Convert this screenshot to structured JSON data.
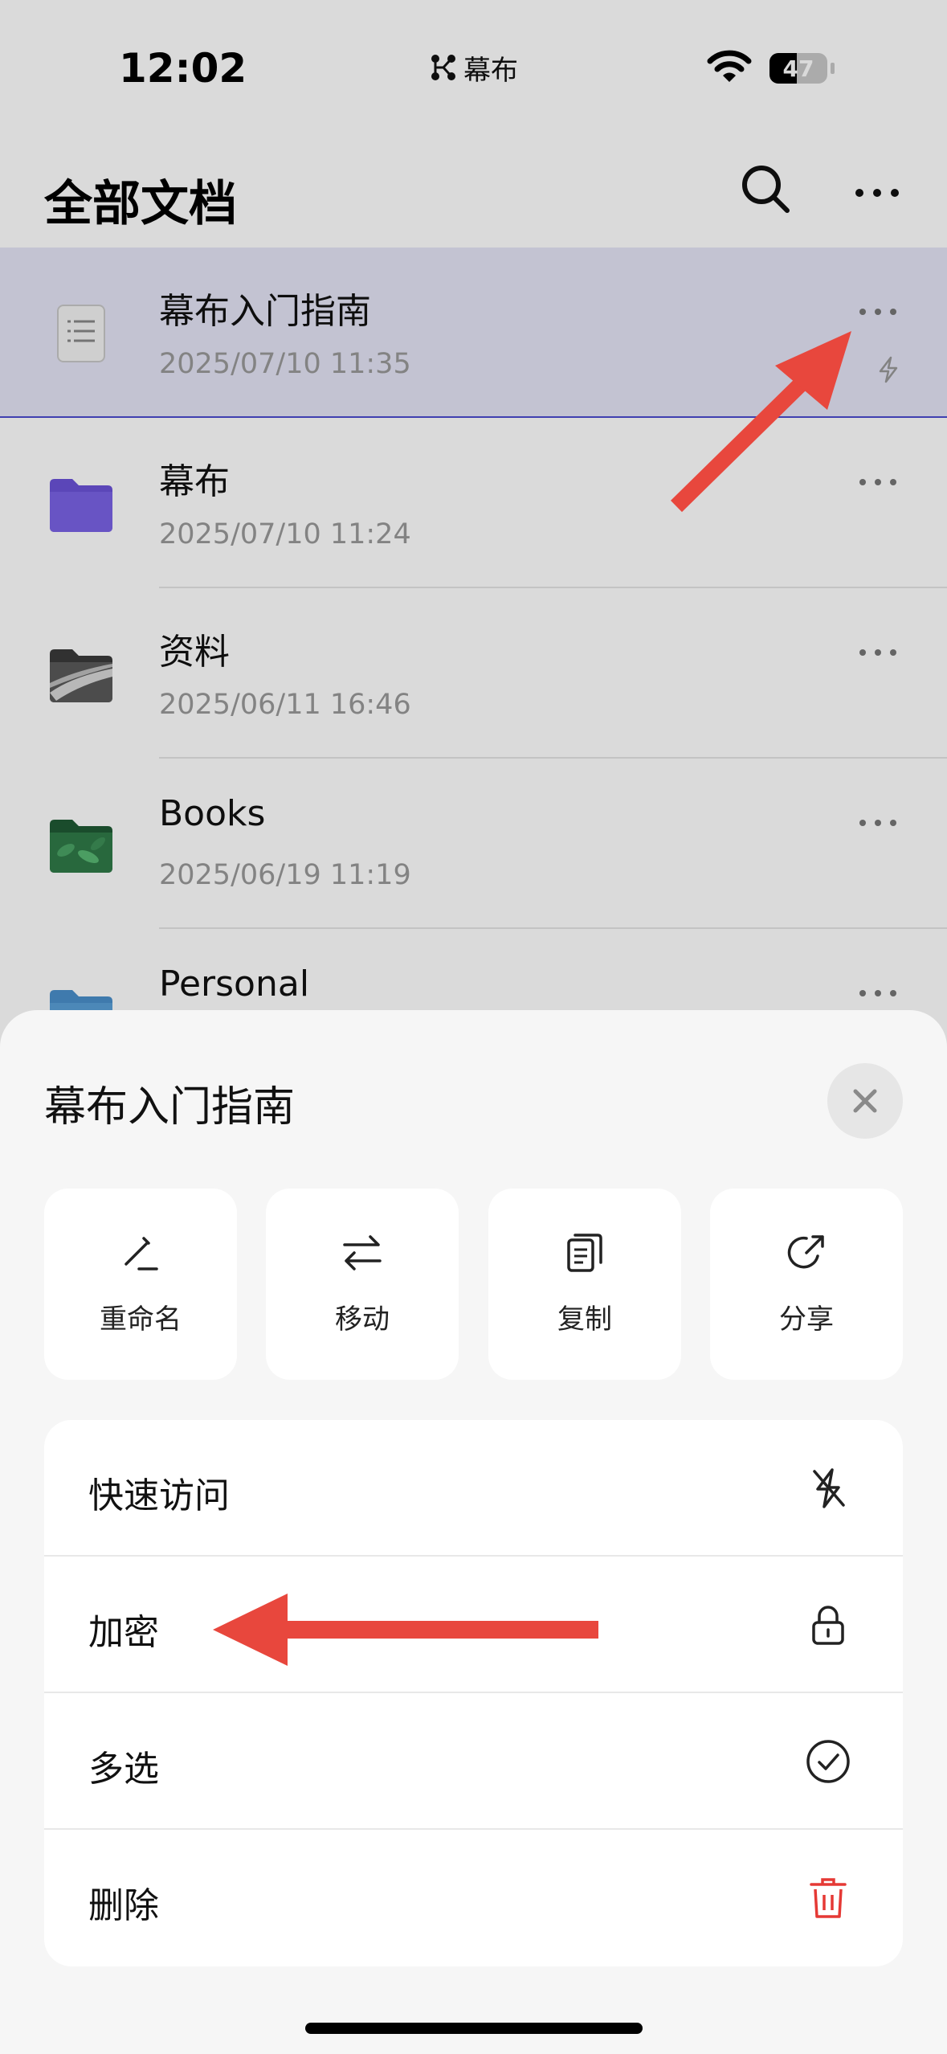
{
  "status_bar": {
    "time": "12:02",
    "island_app": "幕布",
    "battery_percent": 47,
    "battery_label": "47"
  },
  "header": {
    "title": "全部文档"
  },
  "documents": [
    {
      "name": "幕布入门指南",
      "date": "2025/07/10 11:35",
      "type": "document",
      "quick_access": true,
      "selected": true
    },
    {
      "name": "幕布",
      "date": "2025/07/10 11:24",
      "type": "folder",
      "color": "#6b52d8"
    },
    {
      "name": "资料",
      "date": "2025/06/11 16:46",
      "type": "folder-image"
    },
    {
      "name": "Books",
      "date": "2025/06/19 11:19",
      "type": "folder-image"
    },
    {
      "name": "Personal",
      "date": "",
      "type": "folder",
      "color": "#5aa0d8"
    }
  ],
  "sheet": {
    "title": "幕布入门指南",
    "actions": [
      {
        "label": "重命名",
        "icon": "pencil-icon"
      },
      {
        "label": "移动",
        "icon": "arrows-swap-icon"
      },
      {
        "label": "复制",
        "icon": "copy-icon"
      },
      {
        "label": "分享",
        "icon": "share-icon"
      }
    ],
    "menu": [
      {
        "label": "快速访问",
        "icon": "quick-access-off-icon"
      },
      {
        "label": "加密",
        "icon": "lock-icon"
      },
      {
        "label": "多选",
        "icon": "check-circle-icon"
      },
      {
        "label": "删除",
        "icon": "trash-icon",
        "color": "#e53935"
      }
    ]
  },
  "colors": {
    "accent": "#4a4ad0",
    "danger": "#e53935",
    "annotation_arrow": "#e8473d"
  }
}
